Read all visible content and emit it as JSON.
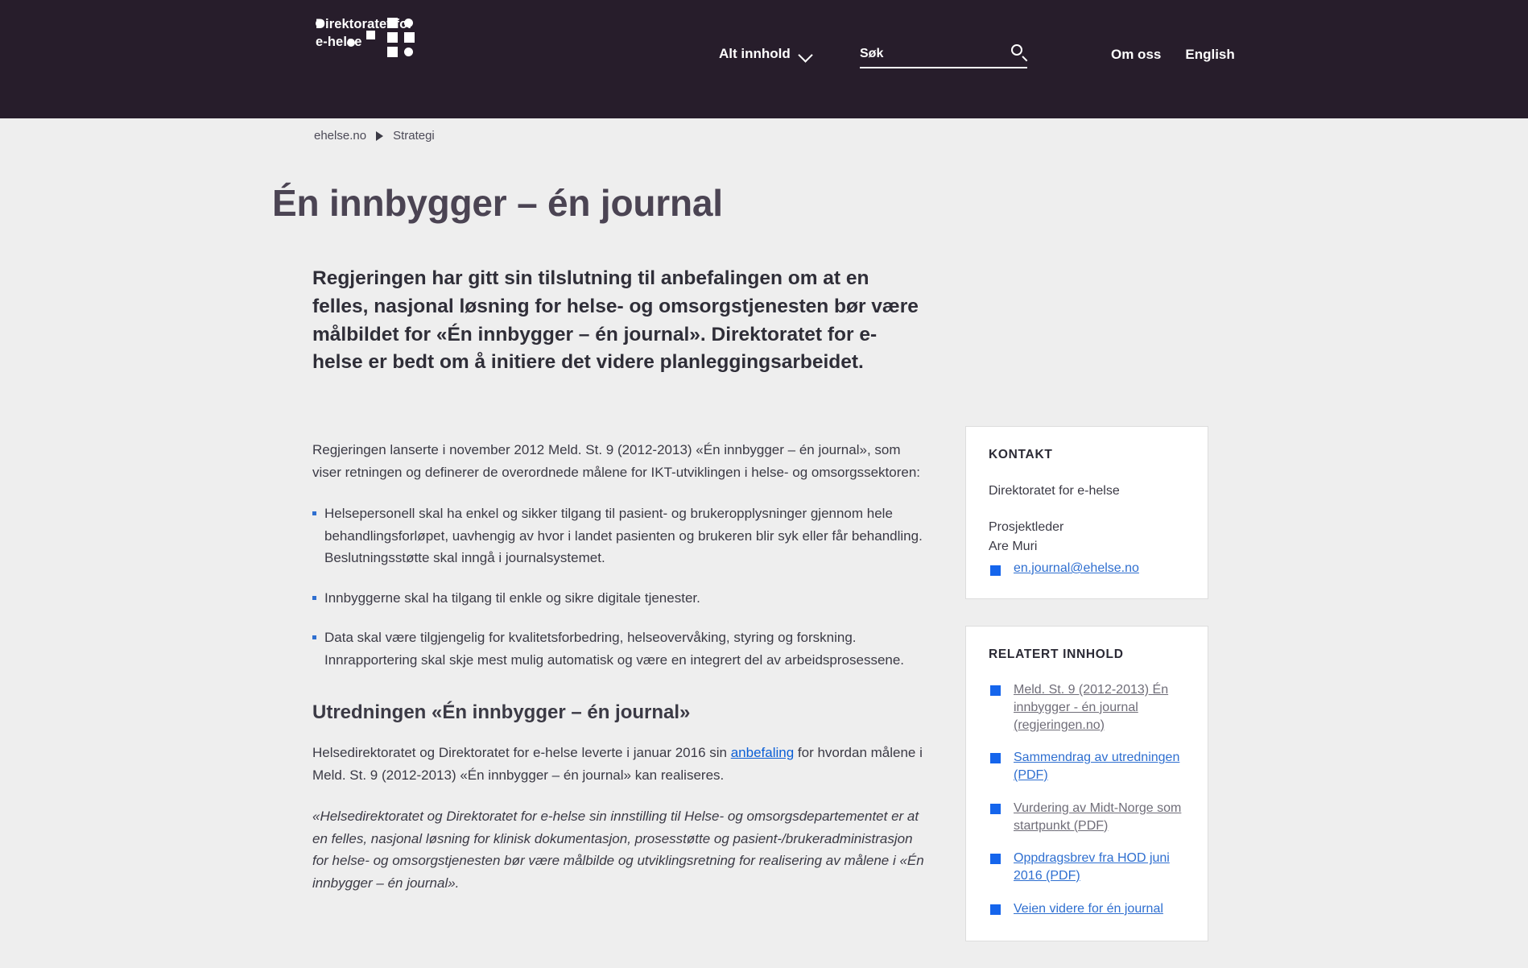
{
  "header": {
    "brand_name": "Direktoratet for\ne-helse",
    "nav_all_label": "Alt innhold",
    "search": {
      "placeholder": "Søk",
      "value": ""
    },
    "links": [
      {
        "label": "Om oss"
      },
      {
        "label": "English"
      }
    ]
  },
  "breadcrumb": {
    "home": "ehelse.no",
    "current": "Strategi"
  },
  "main": {
    "title": "Én innbygger – én journal",
    "lead": "Regjeringen har gitt sin tilslutning til anbefalingen om at en felles, nasjonal løsning for helse- og omsorgstjenesten bør være målbildet for «Én innbygger – én journal». Direktoratet for e-helse er bedt om å initiere det videre planleggingsarbeidet.",
    "intro_paragraph": "Regjeringen lanserte i november 2012 Meld. St. 9 (2012-2013) «Én innbygger – én journal», som viser retningen og definerer de overordnede målene for IKT-utviklingen i helse- og omsorgssektoren:",
    "goals": [
      "Helsepersonell skal ha enkel og sikker tilgang til pasient- og brukeropplysninger gjennom hele behandlingsforløpet, uavhengig av hvor i landet pasienten og brukeren blir syk eller får behandling. Beslutningsstøtte skal inngå i journalsystemet.",
      "Innbyggerne skal ha tilgang til enkle og sikre digitale tjenester.",
      "Data skal være tilgjengelig for kvalitetsforbedring, helseovervåking, styring og forskning. Innrapportering skal skje mest mulig automatisk og være en integrert del av arbeidsprosessene."
    ],
    "section_heading": "Utredningen «Én innbygger – én journal»",
    "section_paragraph_pre": "Helsedirektoratet og Direktoratet for e-helse leverte i januar 2016 sin ",
    "section_link": "anbefaling",
    "section_paragraph_post": " for hvordan målene i Meld. St. 9 (2012-2013) «Én innbygger – én journal» kan realiseres.",
    "quote": "«Helsedirektoratet og Direktoratet for e-helse sin innstilling til Helse- og omsorgsdepartementet er at en felles, nasjonal løsning for klinisk dokumentasjon, prosesstøtte og pasient-/brukeradministrasjon for helse- og omsorgstjenesten bør være målbilde og utviklingsretning for realisering av målene i «Én innbygger – én journal»."
  },
  "sidebar": {
    "contact": {
      "heading": "KONTAKT",
      "organisation": "Direktoratet for e-helse",
      "role_and_name": "Prosjektleder\nAre Muri",
      "email": "en.journal@ehelse.no"
    },
    "related": {
      "heading": "RELATERT INNHOLD",
      "items": [
        {
          "label": "Meld. St. 9 (2012-2013) Én innbygger - én journal (regjeringen.no)",
          "visited": true
        },
        {
          "label": "Sammendrag av utredningen (PDF)",
          "visited": false
        },
        {
          "label": "Vurdering av Midt-Norge som startpunkt (PDF)",
          "visited": true
        },
        {
          "label": "Oppdragsbrev fra HOD juni 2016 (PDF)",
          "visited": false
        },
        {
          "label": "Veien videre for én journal",
          "visited": false
        }
      ]
    }
  },
  "colors": {
    "header_bg": "#271d2b",
    "page_bg": "#eeeeee",
    "link_blue": "#2f6fd0",
    "bullet_blue": "#1565ec",
    "title_text": "#4b4453"
  }
}
